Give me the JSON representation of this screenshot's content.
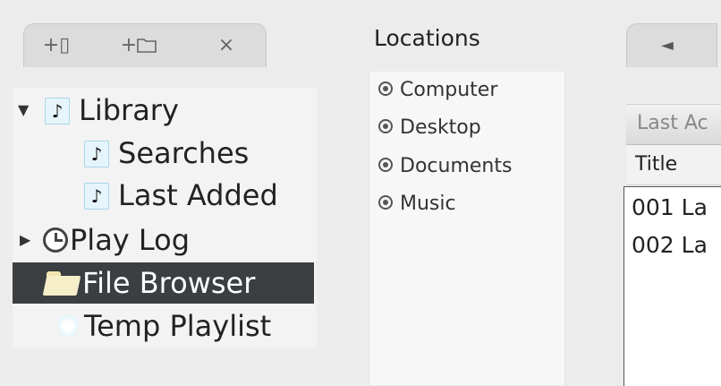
{
  "toolbar": {
    "new_playlist_label": "+▯",
    "new_folder_label": "+🗀",
    "delete_label": "×"
  },
  "sidebar": {
    "items": [
      {
        "label": "Library",
        "icon": "music-note-icon",
        "expanded": true
      },
      {
        "label": "Searches",
        "icon": "music-note-icon"
      },
      {
        "label": "Last Added",
        "icon": "music-note-icon"
      },
      {
        "label": "Play Log",
        "icon": "clock-icon",
        "expanded": false
      },
      {
        "label": "File Browser",
        "icon": "folder-icon",
        "selected": true
      },
      {
        "label": "Temp Playlist",
        "icon": "snowflake-icon"
      }
    ]
  },
  "locations": {
    "title": "Locations",
    "items": [
      "Computer",
      "Desktop",
      "Documents",
      "Music"
    ]
  },
  "right_pane": {
    "back_label": "◄",
    "tab_label": "Last Ac",
    "column_title": "Title",
    "rows": [
      "001 La",
      "002 La"
    ]
  },
  "colors": {
    "selection": "#3b3f42",
    "background": "#ececec"
  }
}
